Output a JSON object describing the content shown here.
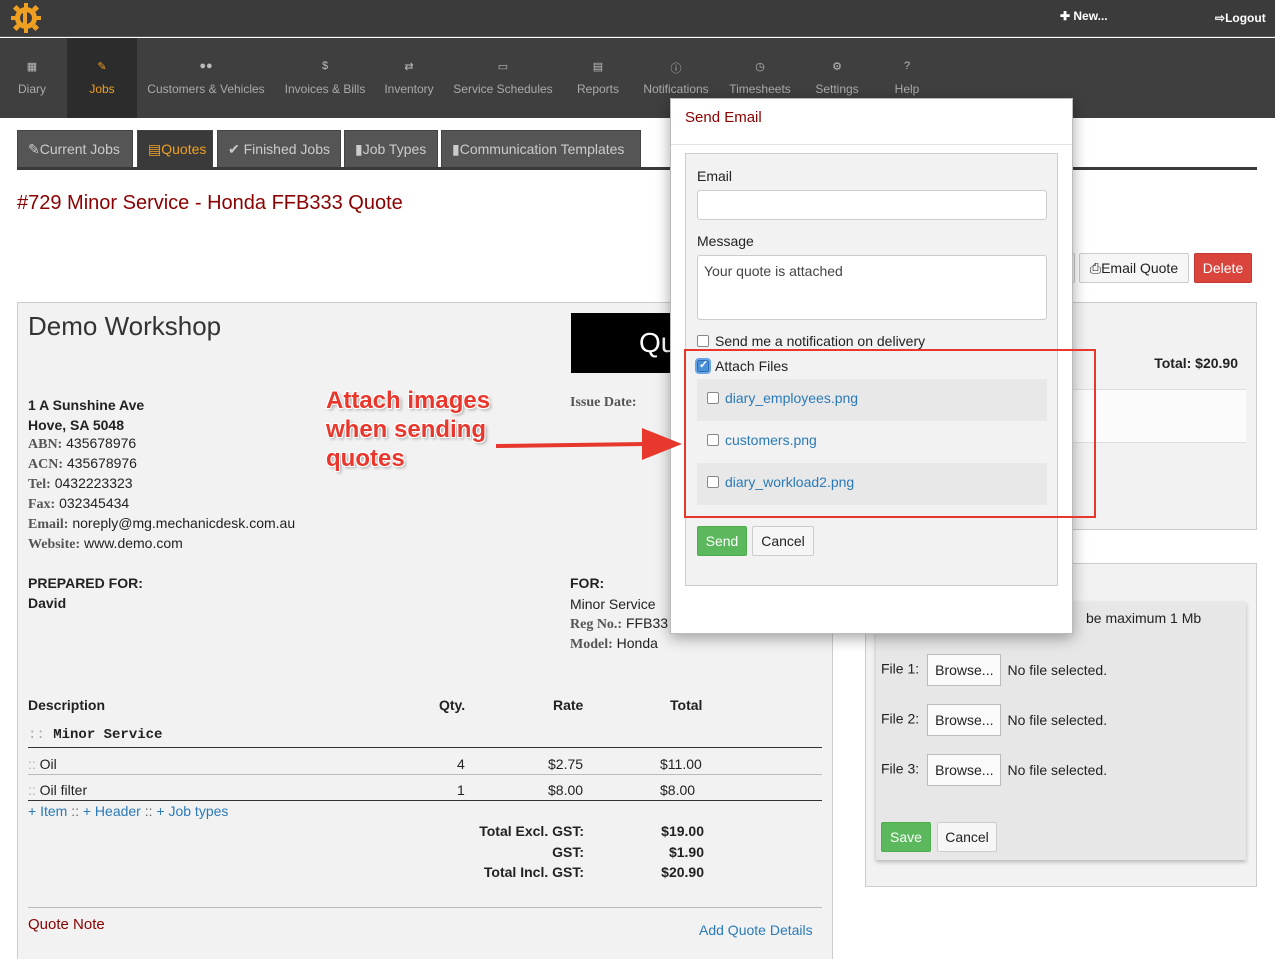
{
  "topbar": {
    "new_label": "New...",
    "logout_label": "Logout"
  },
  "nav": [
    {
      "label": "Diary",
      "icon": "calendar-icon"
    },
    {
      "label": "Jobs",
      "icon": "wrench-icon"
    },
    {
      "label": "Customers & Vehicles",
      "icon": "users-icon"
    },
    {
      "label": "Invoices & Bills",
      "icon": "dollar-icon"
    },
    {
      "label": "Inventory",
      "icon": "retweet-icon"
    },
    {
      "label": "Service Schedules",
      "icon": "calendar-icon"
    },
    {
      "label": "Reports",
      "icon": "chart-icon"
    },
    {
      "label": "Notifications",
      "icon": "info-icon"
    },
    {
      "label": "Timesheets",
      "icon": "clock-icon"
    },
    {
      "label": "Settings",
      "icon": "gears-icon"
    },
    {
      "label": "Help",
      "icon": "question-icon"
    }
  ],
  "subtabs": [
    "Current Jobs",
    "Quotes",
    "Finished Jobs",
    "Job Types",
    "Communication Templates"
  ],
  "page_title": "#729 Minor Service - Honda FFB333 Quote",
  "actions": {
    "email_quote": "Email Quote",
    "delete": "Delete"
  },
  "quote": {
    "workshop_name": "Demo Workshop",
    "banner_text": "Qu",
    "address_line1": "1 A Sunshine Ave",
    "address_line2": "Hove, SA 5048",
    "abn_key": "ABN:",
    "abn": "435678976",
    "acn_key": "ACN:",
    "acn": "435678976",
    "tel_key": "Tel:",
    "tel": "0432223323",
    "fax_key": "Fax:",
    "fax": "032345434",
    "email_key": "Email:",
    "email": "noreply@mg.mechanicdesk.com.au",
    "website_key": "Website:",
    "website": "www.demo.com",
    "issue_date_label": "Issue Date:",
    "prepared_for_label": "PREPARED FOR:",
    "prepared_for": "David",
    "for_label": "FOR:",
    "for_service": "Minor Service",
    "reg_key": "Reg No.:",
    "reg": "FFB33",
    "model_key": "Model:",
    "model": "Honda",
    "columns": {
      "description": "Description",
      "qty": "Qty.",
      "rate": "Rate",
      "total": "Total"
    },
    "section": "Minor Service",
    "rows": [
      {
        "desc": "Oil",
        "qty": "4",
        "rate": "$2.75",
        "total": "$11.00"
      },
      {
        "desc": "Oil filter",
        "qty": "1",
        "rate": "$8.00",
        "total": "$8.00"
      }
    ],
    "links": {
      "item": "+ Item",
      "header": "+ Header",
      "job_types": "+ Job types"
    },
    "totals": [
      {
        "label": "Total Excl. GST:",
        "value": "$19.00"
      },
      {
        "label": "GST:",
        "value": "$1.90"
      },
      {
        "label": "Total Incl. GST:",
        "value": "$20.90"
      }
    ],
    "quote_note": "Quote Note",
    "add_details": "Add Quote Details"
  },
  "right_panel": {
    "total": "Total: $20.90",
    "upload_note": "be maximum 1 Mb",
    "files": [
      {
        "label": "File 1:",
        "browse": "Browse...",
        "status": "No file selected."
      },
      {
        "label": "File 2:",
        "browse": "Browse...",
        "status": "No file selected."
      },
      {
        "label": "File 3:",
        "browse": "Browse...",
        "status": "No file selected."
      }
    ],
    "save": "Save",
    "cancel": "Cancel"
  },
  "modal": {
    "title": "Send Email",
    "email_label": "Email",
    "email_value": "",
    "message_label": "Message",
    "message_value": "Your quote is attached",
    "notify_label": "Send me a notification on delivery",
    "notify_checked": false,
    "attach_label": "Attach Files",
    "attach_checked": true,
    "files": [
      {
        "name": "diary_employees.png",
        "checked": false
      },
      {
        "name": "customers.png",
        "checked": false
      },
      {
        "name": "diary_workload2.png",
        "checked": false
      }
    ],
    "send": "Send",
    "cancel": "Cancel"
  },
  "annotation": {
    "line1": "Attach images",
    "line2": "when sending",
    "line3": "quotes",
    "color": "#e8372c"
  },
  "colors": {
    "accent": "#f0a020",
    "title_red": "#8b0000",
    "link_blue": "#2a7ab8",
    "success": "#5cb85c",
    "danger": "#d9443c"
  }
}
